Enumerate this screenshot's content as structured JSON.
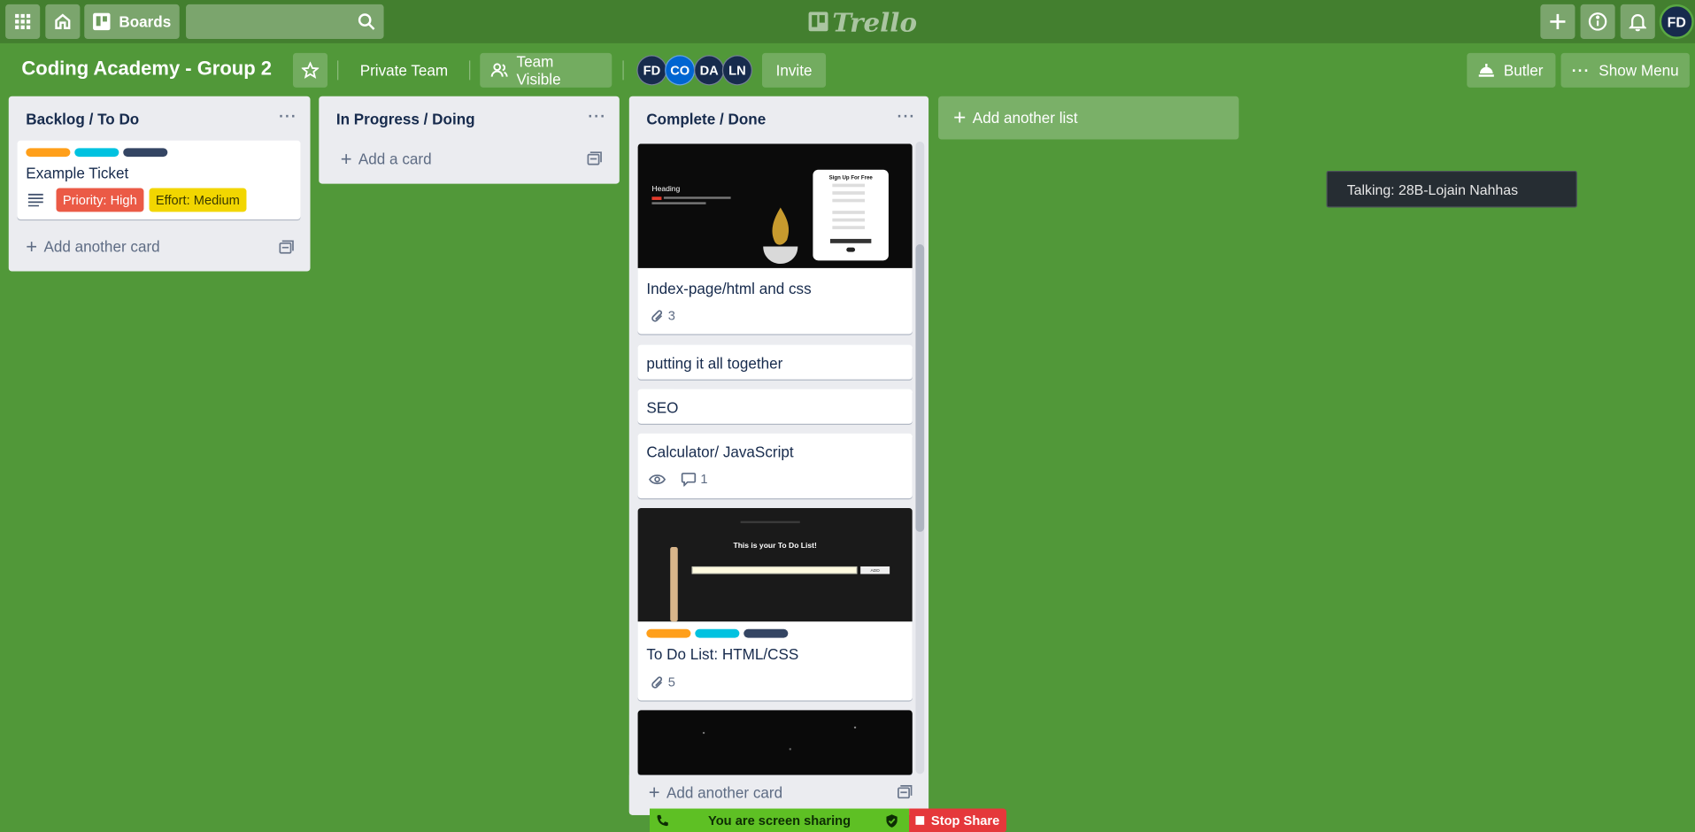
{
  "header": {
    "boards_label": "Boards",
    "search_value": "",
    "logo_text": "Trello",
    "user_initials": "FD"
  },
  "board": {
    "title": "Coding Academy - Group 2",
    "private_team": "Private Team",
    "team_visible": "Team Visible",
    "members": [
      {
        "initials": "FD",
        "color": "#172b4d"
      },
      {
        "initials": "CO",
        "color": "#0065d1"
      },
      {
        "initials": "DA",
        "color": "#172b4d"
      },
      {
        "initials": "LN",
        "color": "#172b4d"
      }
    ],
    "invite_label": "Invite",
    "butler_label": "Butler",
    "show_menu_label": "Show Menu"
  },
  "lists": [
    {
      "title": "Backlog / To Do",
      "menu": "···",
      "cards": [
        {
          "title": "Example Ticket",
          "chips": [
            "Priority: High",
            "Effort: Medium"
          ]
        }
      ],
      "add_label": "Add another card"
    },
    {
      "title": "In Progress / Doing",
      "menu": "···",
      "cards": [],
      "add_label": "Add a card"
    },
    {
      "title": "Complete / Done",
      "menu": "···",
      "cards": [
        {
          "title": "Index-page/html and css",
          "attachments": "3"
        },
        {
          "title": "putting it all together"
        },
        {
          "title": "SEO"
        },
        {
          "title": "Calculator/ JavaScript",
          "comments": "1"
        },
        {
          "title": "To Do List: HTML/CSS",
          "attachments": "5"
        }
      ],
      "add_label": "Add another card"
    }
  ],
  "cover_1": {
    "heading": "Heading",
    "form_title": "Sign Up For Free"
  },
  "cover_2": {
    "heading": "This is your To Do List!",
    "button": "ADD"
  },
  "label_colors": {
    "orange": "#ff9f1a",
    "sky": "#00c2e0",
    "navy": "#344563",
    "red": "#eb5a46",
    "yellow": "#f2d600"
  },
  "add_list_label": "Add another list",
  "talking_text": "Talking: 28B-Lojain Nahhas",
  "screen_share": {
    "status": "You are screen sharing",
    "stop": "Stop Share"
  }
}
